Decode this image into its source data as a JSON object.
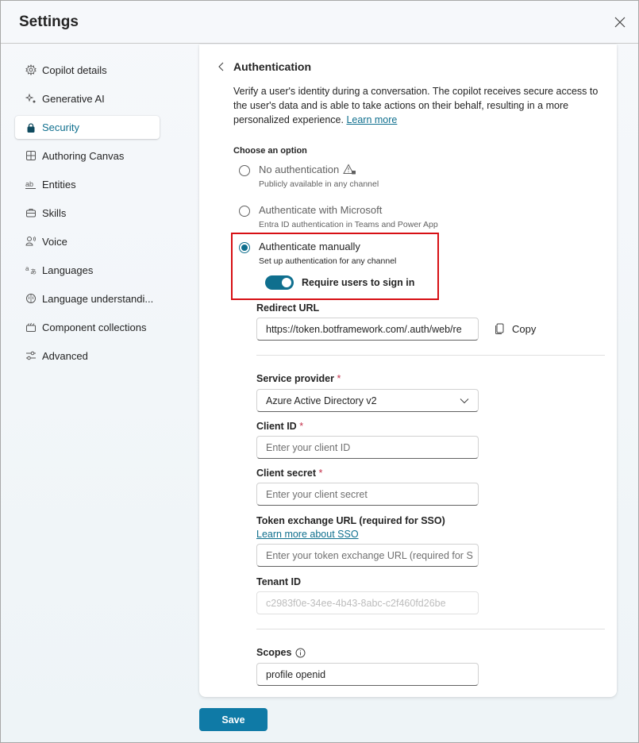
{
  "dialog": {
    "title": "Settings",
    "close_icon": "close-icon"
  },
  "sidebar": {
    "items": [
      {
        "label": "Copilot details",
        "icon": "gear-icon",
        "active": false
      },
      {
        "label": "Generative AI",
        "icon": "sparkle-icon",
        "active": false
      },
      {
        "label": "Security",
        "icon": "lock-icon",
        "active": true
      },
      {
        "label": "Authoring Canvas",
        "icon": "grid-icon",
        "active": false
      },
      {
        "label": "Entities",
        "icon": "text-ab-icon",
        "active": false
      },
      {
        "label": "Skills",
        "icon": "briefcase-icon",
        "active": false
      },
      {
        "label": "Voice",
        "icon": "person-voice-icon",
        "active": false
      },
      {
        "label": "Languages",
        "icon": "translate-icon",
        "active": false
      },
      {
        "label": "Language understandi...",
        "icon": "brain-icon",
        "active": false
      },
      {
        "label": "Component collections",
        "icon": "collection-icon",
        "active": false
      },
      {
        "label": "Advanced",
        "icon": "sliders-icon",
        "active": false
      }
    ]
  },
  "auth": {
    "back_icon": "chevron-left-icon",
    "title": "Authentication",
    "description": "Verify a user's identity during a conversation. The copilot receives secure access to the user's data and is able to take actions on their behalf, resulting in a more personalized experience. ",
    "learn_more": "Learn more",
    "choose_label": "Choose an option",
    "options": [
      {
        "label": "No authentication",
        "sub": "Publicly available in any channel",
        "selected": false,
        "icon": "warning-lock-icon"
      },
      {
        "label": "Authenticate with Microsoft",
        "sub": "Entra ID authentication in Teams and Power App",
        "selected": false
      },
      {
        "label": "Authenticate manually",
        "sub": "Set up authentication for any channel",
        "selected": true
      }
    ],
    "toggle": {
      "label": "Require users to sign in",
      "on": true
    },
    "redirect_url": {
      "label": "Redirect URL",
      "value": "https://token.botframework.com/.auth/web/re",
      "copy_label": "Copy"
    },
    "service_provider": {
      "label": "Service provider",
      "required": "*",
      "value": "Azure Active Directory v2"
    },
    "client_id": {
      "label": "Client ID",
      "required": "*",
      "placeholder": "Enter your client ID"
    },
    "client_secret": {
      "label": "Client secret",
      "required": "*",
      "placeholder": "Enter your client secret"
    },
    "token_exchange": {
      "label": "Token exchange URL (required for SSO) ",
      "link": "Learn more about SSO",
      "placeholder": "Enter your token exchange URL (required for S"
    },
    "tenant_id": {
      "label": "Tenant ID",
      "value": "c2983f0e-34ee-4b43-8abc-c2f460fd26be"
    },
    "scopes": {
      "label": "Scopes",
      "value": "profile openid"
    }
  },
  "footer": {
    "save_label": "Save"
  },
  "colors": {
    "accent": "#0f6f8e",
    "save": "#0f7aa6",
    "highlight": "#d70f14",
    "required": "#c4314b"
  }
}
